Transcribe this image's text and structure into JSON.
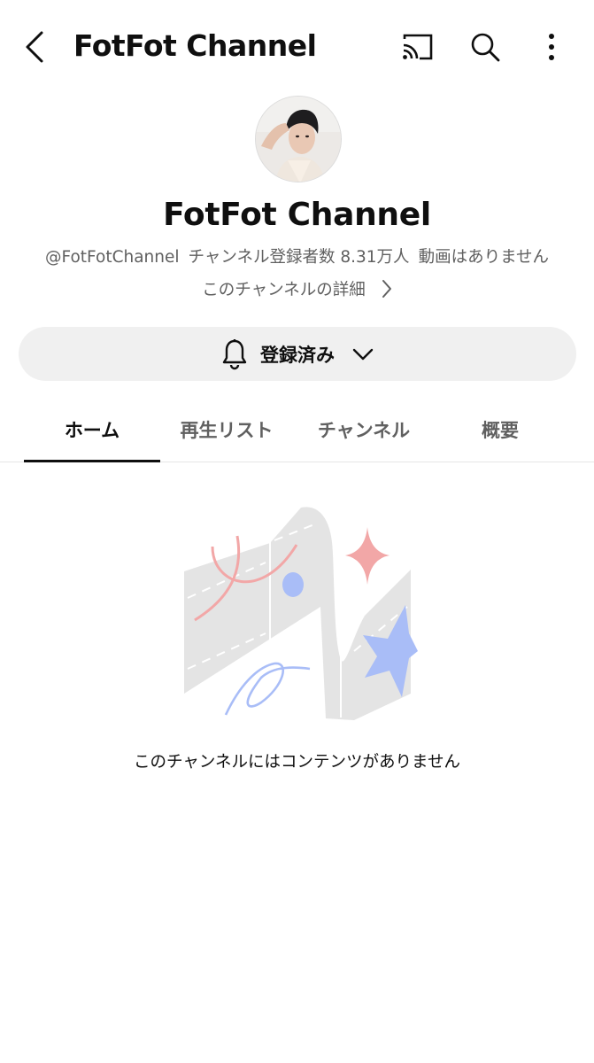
{
  "topbar": {
    "title": "FotFot Channel",
    "icons": [
      "back-icon",
      "cast-icon",
      "search-icon",
      "more-vert-icon"
    ]
  },
  "channel": {
    "name": "FotFot Channel",
    "handle": "@FotFotChannel",
    "subscribers": "チャンネル登録者数 8.31万人",
    "videos": "動画はありません",
    "details_link": "このチャンネルの詳細"
  },
  "subscribe": {
    "label": "登録済み",
    "icon": "bell-icon"
  },
  "tabs": [
    {
      "label": "ホーム",
      "active": true
    },
    {
      "label": "再生リスト",
      "active": false
    },
    {
      "label": "チャンネル",
      "active": false
    },
    {
      "label": "概要",
      "active": false
    }
  ],
  "empty_state": {
    "message": "このチャンネルにはコンテンツがありません"
  },
  "colors": {
    "text_primary": "#0f0f0f",
    "text_secondary": "#606060",
    "button_bg": "#f0f0f0",
    "illustration_gray": "#e4e4e4",
    "illustration_pink": "#f2a7a7",
    "illustration_blue": "#a9bdf7"
  }
}
